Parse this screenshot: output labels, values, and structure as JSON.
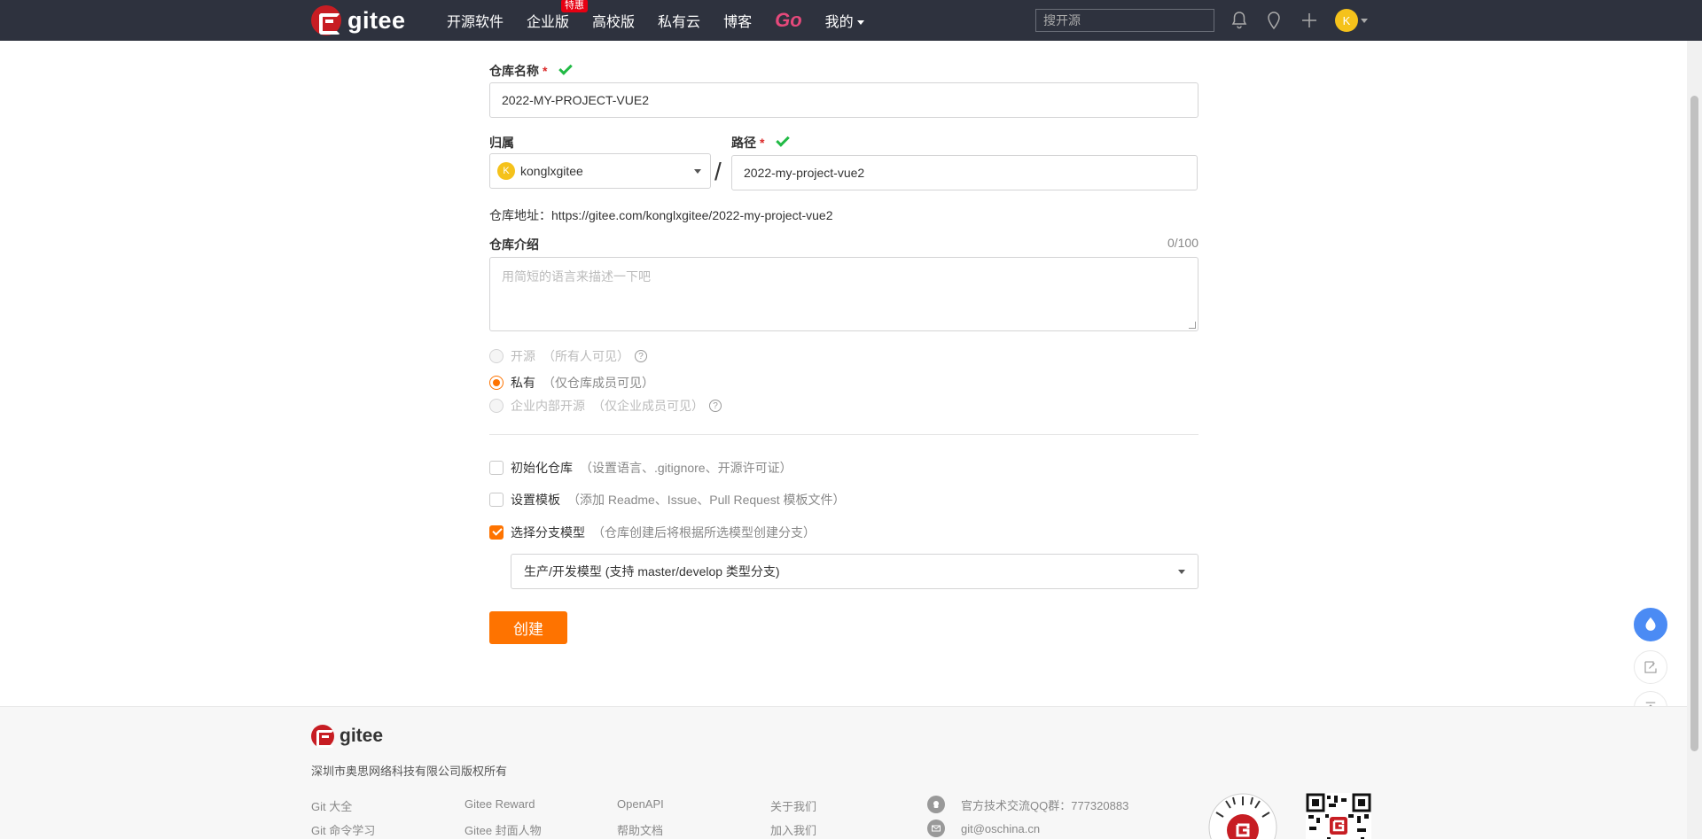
{
  "header": {
    "logo_text": "gitee",
    "nav": [
      {
        "label": "开源软件"
      },
      {
        "label": "企业版",
        "badge": "特惠"
      },
      {
        "label": "高校版"
      },
      {
        "label": "私有云"
      },
      {
        "label": "博客"
      },
      {
        "label": "Go"
      },
      {
        "label": "我的"
      }
    ],
    "search_placeholder": "搜开源",
    "avatar_letter": "K"
  },
  "form": {
    "repo_name_label": "仓库名称",
    "required_mark": "*",
    "repo_name_value": "2022-MY-PROJECT-VUE2",
    "owner_label": "归属",
    "owner_avatar_letter": "K",
    "owner_value": "konglxgitee",
    "slash": "/",
    "path_label": "路径",
    "path_value": "2022-my-project-vue2",
    "repo_url": "仓库地址：https://gitee.com/konglxgitee/2022-my-project-vue2",
    "desc_label": "仓库介绍",
    "desc_counter": "0/100",
    "desc_placeholder": "用简短的语言来描述一下吧",
    "visibility": [
      {
        "label": "开源",
        "hint": "（所有人可见）",
        "selected": false,
        "disabled": true
      },
      {
        "label": "私有",
        "hint": "（仅仓库成员可见）",
        "selected": true,
        "disabled": false
      },
      {
        "label": "企业内部开源",
        "hint": "（仅企业成员可见）",
        "selected": false,
        "disabled": true
      }
    ],
    "options": [
      {
        "label": "初始化仓库",
        "hint": "（设置语言、.gitignore、开源许可证）",
        "checked": false
      },
      {
        "label": "设置模板",
        "hint": "（添加 Readme、Issue、Pull Request 模板文件）",
        "checked": false
      },
      {
        "label": "选择分支模型",
        "hint": "（仓库创建后将根据所选模型创建分支）",
        "checked": true
      }
    ],
    "branch_model_value": "生产/开发模型 (支持 master/develop 类型分支)",
    "create_label": "创建"
  },
  "footer": {
    "logo_text": "gitee",
    "copyright": "深圳市奥思网络科技有限公司版权所有",
    "links": [
      [
        "Git 大全",
        "Git 命令学习"
      ],
      [
        "Gitee Reward",
        "Gitee 封面人物"
      ],
      [
        "OpenAPI",
        "帮助文档"
      ],
      [
        "关于我们",
        "加入我们"
      ]
    ],
    "qq_group": "官方技术交流QQ群：777320883",
    "email": "git@oschina.cn"
  },
  "colors": {
    "accent": "#fe7300",
    "header_bg": "#2e323e",
    "brand_red": "#c71d23",
    "success_green": "#21ba45"
  }
}
